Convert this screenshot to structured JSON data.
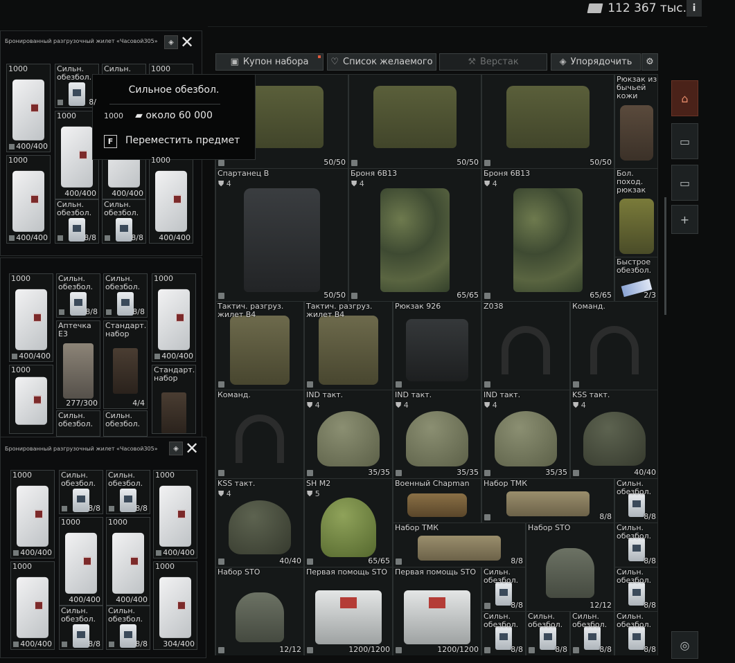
{
  "header": {
    "money": "112 367 тыс.",
    "info_label": "i"
  },
  "toolbar": {
    "kit_coupon": "Купон набора",
    "wishlist": "Список желаемого",
    "workbench": "Верстак",
    "sort": "Упорядочить"
  },
  "tooltip": {
    "title": "Сильное обезбол.",
    "price": "около 60 000",
    "key": "F",
    "action": "Переместить предмет"
  },
  "panels": {
    "title": "Бронированный разгрузочный жилет «Часовой305»"
  },
  "stash": [
    {
      "name": "",
      "armor": "",
      "count": "50/50"
    },
    {
      "name": "",
      "armor": "",
      "count": "50/50"
    },
    {
      "name": "",
      "armor": "",
      "count": "50/50"
    },
    {
      "name": "Рюкзак из бычьей кожи",
      "armor": "",
      "count": ""
    },
    {
      "name": "Спартанец В",
      "armor": "4",
      "count": "50/50"
    },
    {
      "name": "Броня 6В13",
      "armor": "4",
      "count": "65/65"
    },
    {
      "name": "Броня 6В13",
      "armor": "4",
      "count": "65/65"
    },
    {
      "name": "Бол. поход. рюкзак",
      "armor": "",
      "count": ""
    },
    {
      "name": "Быстрое обезбол.",
      "armor": "",
      "count": "2/3"
    },
    {
      "name": "Тактич. разгруз. жилет В4",
      "armor": "",
      "count": ""
    },
    {
      "name": "Тактич. разгруз. жилет В4",
      "armor": "",
      "count": ""
    },
    {
      "name": "Рюкзак 926",
      "armor": "",
      "count": ""
    },
    {
      "name": "Z038",
      "armor": "",
      "count": ""
    },
    {
      "name": "Команд.",
      "armor": "",
      "count": ""
    },
    {
      "name": "Команд.",
      "armor": "",
      "count": ""
    },
    {
      "name": "IND такт.",
      "armor": "4",
      "count": "35/35"
    },
    {
      "name": "IND такт.",
      "armor": "4",
      "count": "35/35"
    },
    {
      "name": "IND такт.",
      "armor": "4",
      "count": "35/35"
    },
    {
      "name": "KSS такт.",
      "armor": "4",
      "count": "40/40"
    },
    {
      "name": "KSS такт.",
      "armor": "4",
      "count": "40/40"
    },
    {
      "name": "SH M2",
      "armor": "5",
      "count": "65/65"
    },
    {
      "name": "Военный Chapman",
      "armor": "",
      "count": ""
    },
    {
      "name": "Набор ТМК",
      "armor": "",
      "count": "8/8"
    },
    {
      "name": "Сильн. обезбол.",
      "armor": "",
      "count": "8/8"
    },
    {
      "name": "Набор ТМК",
      "armor": "",
      "count": "8/8"
    },
    {
      "name": "Набор STO",
      "armor": "",
      "count": "12/12"
    },
    {
      "name": "Сильн. обезбол.",
      "armor": "",
      "count": "8/8"
    },
    {
      "name": "Набор STO",
      "armor": "",
      "count": "12/12"
    },
    {
      "name": "Первая помощь STO",
      "armor": "",
      "count": "1200/1200"
    },
    {
      "name": "Первая помощь STO",
      "armor": "",
      "count": "1200/1200"
    },
    {
      "name": "Сильн. обезбол.",
      "armor": "",
      "count": "8/8"
    },
    {
      "name": "Сильн. обезбол.",
      "armor": "",
      "count": "8/8"
    },
    {
      "name": "Сильн. обезбол.",
      "armor": "",
      "count": "8/8"
    },
    {
      "name": "Сильн. обезбол.",
      "armor": "",
      "count": "8/8"
    },
    {
      "name": "Сильн. обезбол.",
      "armor": "",
      "count": "8/8"
    },
    {
      "name": "Сильн. обезбол.",
      "armor": "",
      "count": "8/8"
    }
  ],
  "panel1": [
    {
      "name": "1000",
      "count": "400/400"
    },
    {
      "name": "Сильн. обезбол.",
      "count": "8/"
    },
    {
      "name": "Сильн.",
      "count": ""
    },
    {
      "name": "1000",
      "count": ""
    },
    {
      "name": "1000",
      "count": "400/400"
    },
    {
      "name": "1000",
      "count": "400/400"
    },
    {
      "name": "1000",
      "count": "400/400"
    },
    {
      "name": "1000",
      "count": "400/400"
    },
    {
      "name": "Сильн. обезбол.",
      "count": "8/8"
    },
    {
      "name": "Сильн. обезбол.",
      "count": "8/8"
    }
  ],
  "panel2": [
    {
      "name": "1000",
      "count": "400/400"
    },
    {
      "name": "Сильн. обезбол.",
      "count": "8/8"
    },
    {
      "name": "Сильн. обезбол.",
      "count": "8/8"
    },
    {
      "name": "1000",
      "count": "400/400"
    },
    {
      "name": "Аптечка Е3",
      "count": "277/300"
    },
    {
      "name": "Стандарт. набор",
      "count": "4/4"
    },
    {
      "name": "1000",
      "count": ""
    },
    {
      "name": "Стандарт. набор",
      "count": ""
    },
    {
      "name": "Сильн. обезбол.",
      "count": ""
    },
    {
      "name": "Сильн. обезбол.",
      "count": ""
    }
  ],
  "panel3": [
    {
      "name": "1000",
      "count": "400/400"
    },
    {
      "name": "Сильн. обезбол.",
      "count": "8/8"
    },
    {
      "name": "Сильн. обезбол.",
      "count": "8/8"
    },
    {
      "name": "1000",
      "count": "400/400"
    },
    {
      "name": "1000",
      "count": "400/400"
    },
    {
      "name": "1000",
      "count": "400/400"
    },
    {
      "name": "1000",
      "count": "400/400"
    },
    {
      "name": "Сильн. обезбол.",
      "count": "8/8"
    },
    {
      "name": "Сильн. обезбол.",
      "count": "8/8"
    },
    {
      "name": "1000",
      "count": "304/400"
    }
  ]
}
